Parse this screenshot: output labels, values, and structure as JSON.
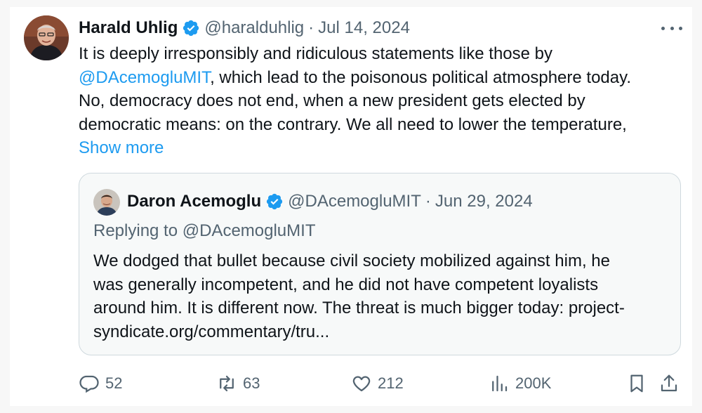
{
  "tweet": {
    "author_name": "Harald Uhlig",
    "handle": "@haralduhlig",
    "separator": "·",
    "date": "Jul 14, 2024",
    "text_line1": "It is deeply irresponsibly and ridiculous statements like those by",
    "mention": "@DAcemogluMIT",
    "text_line2_rest": ", which lead to the poisonous political atmosphere today.",
    "text_line3": "No, democracy does not end, when a new president gets elected by",
    "text_line4": "democratic means: on the contrary.  We all need to lower the temperature,",
    "show_more": "Show more",
    "verified_icon": "verified-badge-icon",
    "more_icon": "more-horizontal-icon"
  },
  "quoted_tweet": {
    "author_name": "Daron Acemoglu",
    "handle": "@DAcemogluMIT",
    "separator": "·",
    "date": "Jun 29, 2024",
    "replying_to": "Replying to @DAcemogluMIT",
    "text_line1": "We dodged that bullet because civil society mobilized against him, he",
    "text_line2": "was generally incompetent, and he did not have competent loyalists",
    "text_line3": "around him. It is different now. The threat is much bigger today: project-",
    "text_line4": "syndicate.org/commentary/tru..."
  },
  "actions": {
    "replies": "52",
    "retweets": "63",
    "likes": "212",
    "views": "200K",
    "icons": [
      "reply-icon",
      "retweet-icon",
      "like-icon",
      "views-icon",
      "bookmark-icon",
      "share-icon"
    ]
  },
  "colors": {
    "accent": "#1d9bf0",
    "text": "#0f1419",
    "muted": "#536471",
    "border": "#cfd9de"
  }
}
